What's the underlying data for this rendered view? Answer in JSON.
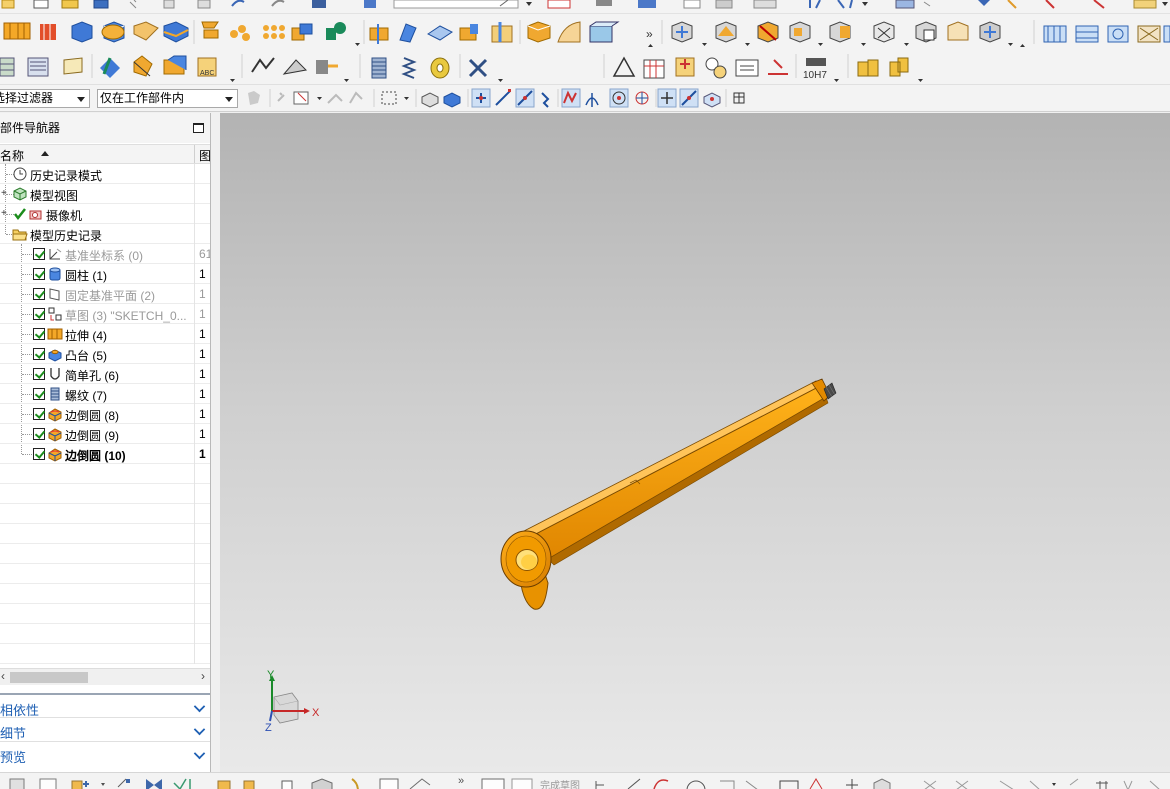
{
  "filter_bar": {
    "type_filter": "选择过滤器",
    "scope_filter": "仅在工作部件内"
  },
  "navigator": {
    "title": "部件导航器",
    "column_name": "名称",
    "column_2": "图",
    "tree": [
      {
        "label": "历史记录模式",
        "icon": "clock-icon",
        "level": 0,
        "expander": "",
        "checkbox": false,
        "greyed": false,
        "bold": false,
        "col2": ""
      },
      {
        "label": "模型视图",
        "icon": "model-views-icon",
        "level": 0,
        "expander": "+",
        "checkbox": false,
        "greyed": false,
        "bold": false,
        "col2": ""
      },
      {
        "label": "摄像机",
        "icon": "camera-icon",
        "level": 0,
        "expander": "+",
        "checkbox": false,
        "greyed": false,
        "bold": false,
        "col2": ""
      },
      {
        "label": "模型历史记录",
        "icon": "folder-open-icon",
        "level": 0,
        "expander": "-",
        "checkbox": false,
        "greyed": false,
        "bold": false,
        "col2": ""
      },
      {
        "label": "基准坐标系 (0)",
        "icon": "datum-csys-icon",
        "level": 1,
        "checkbox": true,
        "greyed": true,
        "bold": false,
        "col2": "61"
      },
      {
        "label": "圆柱 (1)",
        "icon": "cylinder-icon",
        "level": 1,
        "checkbox": true,
        "greyed": false,
        "bold": false,
        "col2": "1"
      },
      {
        "label": "固定基准平面 (2)",
        "icon": "datum-plane-icon",
        "level": 1,
        "checkbox": true,
        "greyed": true,
        "bold": false,
        "col2": "1"
      },
      {
        "label": "草图 (3) \"SKETCH_0...",
        "icon": "sketch-icon",
        "level": 1,
        "checkbox": true,
        "greyed": true,
        "bold": false,
        "col2": "1"
      },
      {
        "label": "拉伸 (4)",
        "icon": "extrude-icon",
        "level": 1,
        "checkbox": true,
        "greyed": false,
        "bold": false,
        "col2": "1"
      },
      {
        "label": "凸台 (5)",
        "icon": "boss-icon",
        "level": 1,
        "checkbox": true,
        "greyed": false,
        "bold": false,
        "col2": "1"
      },
      {
        "label": "简单孔 (6)",
        "icon": "hole-icon",
        "level": 1,
        "checkbox": true,
        "greyed": false,
        "bold": false,
        "col2": "1"
      },
      {
        "label": "螺纹 (7)",
        "icon": "thread-icon",
        "level": 1,
        "checkbox": true,
        "greyed": false,
        "bold": false,
        "col2": "1"
      },
      {
        "label": "边倒圆 (8)",
        "icon": "edge-blend-icon",
        "level": 1,
        "checkbox": true,
        "greyed": false,
        "bold": false,
        "col2": "1"
      },
      {
        "label": "边倒圆 (9)",
        "icon": "edge-blend-icon",
        "level": 1,
        "checkbox": true,
        "greyed": false,
        "bold": false,
        "col2": "1"
      },
      {
        "label": "边倒圆 (10)",
        "icon": "edge-blend-icon",
        "level": 1,
        "checkbox": true,
        "greyed": false,
        "bold": true,
        "col2": "1"
      }
    ],
    "panels": {
      "dependencies": "相依性",
      "details": "细节",
      "preview": "预览"
    }
  },
  "toolbar_3": {
    "fit_tolerance": "10H7"
  },
  "bottom_toolbar": {
    "finish_sketch": "完成草图"
  },
  "triad": {
    "x": "X",
    "y": "Y",
    "z": "Z"
  },
  "colors": {
    "part_orange": "#f29b00",
    "part_orange_dark": "#b46a00",
    "viewport_top": "#b3b3b3",
    "viewport_bottom": "#e9e9e9",
    "link_blue": "#1e5fb3",
    "check_green": "#1b8c1b"
  }
}
